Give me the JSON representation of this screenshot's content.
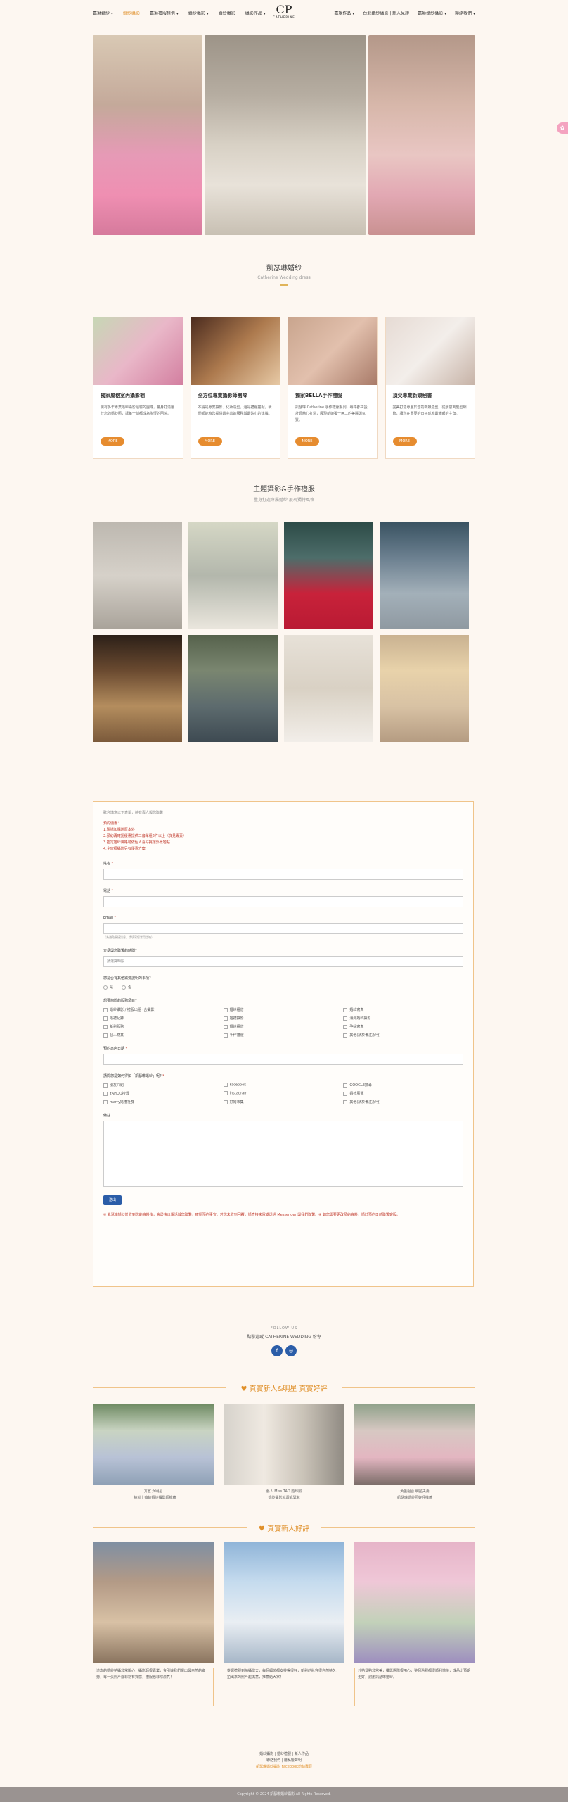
{
  "nav": {
    "left": [
      "嘉琳婚紗 ▾",
      "婚紗攝影",
      "嘉琳禮服租借 ▾",
      "婚紗攝影 ▾",
      "婚紗攝影",
      "攝影作品 ▾"
    ],
    "right": [
      "嘉琳作品 ▾",
      "台北婚紗攝影 | 新人見證",
      "嘉琳婚紗攝影 ▾",
      "聯絡我們 ▾"
    ],
    "active_index": 1
  },
  "logo": {
    "mark": "CP",
    "text": "CATHERINE"
  },
  "side_tab": "✿",
  "section1": {
    "title": "凱瑟琳婚紗",
    "subtitle": "Catherine Wedding dress"
  },
  "cards": [
    {
      "title": "獨家風格室內攝影棚",
      "desc": "擁有多年專業婚紗攝影經驗的團隊，量身打造屬於您的婚紗照，讓每一刻都成為永恆的回憶。",
      "more": "MORE"
    },
    {
      "title": "全方位專業攝影師團隊",
      "desc": "不論是專業攝影、化妝造型，還是禮服搭配，我們都能為您提供最完善的服務與最貼心的建議。",
      "more": "MORE"
    },
    {
      "title": "獨家BELLA手作禮服",
      "desc": "凱瑟琳 Catherine 手作禮服系列，每件都由設計師精心打造，展現新娘獨一無二的美麗與氣質。",
      "more": "MORE"
    },
    {
      "title": "頂尖專業新娘秘書",
      "desc": "完美打造專屬於您的新娘造型，從妝容到髮型細節，讓您在重要的日子成為最耀眼的主角。",
      "more": "MORE"
    }
  ],
  "section2": {
    "title": "主題攝影&手作禮服",
    "subtitle": "量身打造專屬婚紗 展現獨特風格"
  },
  "form": {
    "note": "歡迎填寫以下表單，將有專人與您聯繫",
    "warnings": [
      "預約優惠：",
      "1.現場加購送原本外",
      "2.預約再確認優惠提供三套單租2件以上（詳見專頁）",
      "3.指定婚紗風格可依個人喜好挑選外景地點",
      "4.全家福攝影另有優惠方案"
    ],
    "name_label": "姓名",
    "phone_label": "電話",
    "email_label": "Email",
    "email_help": "（為避免漏接訊息，請填寫您常用信箱）",
    "budget_label": "方便與您聯繫的時間?",
    "budget_value": "請選擇時段",
    "contact_label": "您是否有其他需要說明的事項?",
    "radio": [
      "是",
      "否"
    ],
    "services_label": "想要詢問的服務項目?",
    "services": [
      "婚紗攝影 / 禮服出租 (含攝影)",
      "婚紗租借",
      "婚紗寫真",
      "婚禮紀錄",
      "婚禮攝影",
      "海外婚紗攝影",
      "新秘服務",
      "婚紗租借",
      "孕婦寫真",
      "個人寫真",
      "手作禮服",
      "其他(請於備註說明)"
    ],
    "date_label": "預約來店日期",
    "source_label": "請問您是如何得知「凱瑟琳婚紗」呢?",
    "sources": [
      "朋友介紹",
      "Facebook",
      "GOOGLE搜尋",
      "YAHOO搜尋",
      "Instagram",
      "婚禮展覽",
      "marry婚禮社群",
      "好婚市集",
      "其他(請於備註說明)"
    ],
    "notes_label": "備註",
    "submit": "送出",
    "footer": "※ 凱瑟琳婚紗於收到您的資料後，會盡快以電話與您聯繫，確認預約事宜。若您未收到回覆，請直接來電或透過 Messenger 與我們聯繫。※ 如您需要更改預約資料，請於預約日前聯繫客服。"
  },
  "follow": {
    "title": "FOLLOW US",
    "subtitle": "點擊追蹤 CATHERINE WEDDING 粉專",
    "fb": "f",
    "ig": "◎"
  },
  "reviews1": {
    "title": "♥ 真實新人&明星 真實好評",
    "items": [
      {
        "caption": "方宣 女明星\n一拍就上癮的婚紗攝影師推薦"
      },
      {
        "caption": "藝人 Miss TAO 婚紗照\n婚紗攝影就選凱瑟琳"
      },
      {
        "caption": "黃金組合 明星夫妻\n凱瑟琳婚紗照好評推薦"
      }
    ]
  },
  "reviews2": {
    "title": "♥ 真實新人好評",
    "items": [
      {
        "text": "這次的婚紗拍攝非常開心，攝影師很專業，會引導我們擺出最自然的姿勢，每一張照片都非常有質感，禮服也非常漂亮！"
      },
      {
        "text": "從選禮服到拍攝當天，每個細節都安排得很好，新秘的妝容很自然持久，拍出來的照片超滿意，推薦給大家！"
      },
      {
        "text": "外拍景點非常美，攝影團隊很用心，整個過程都很順利愉快，成品比預期更好，謝謝凱瑟琳婚紗。"
      }
    ]
  },
  "footer": {
    "links": "婚紗攝影 | 婚紗禮服 | 新人作品",
    "line2": "聯絡我們 | 隱私權聲明",
    "line3": "凱瑟琳婚紗攝影 Facebook粉絲專頁",
    "copyright": "Copyright © 2024 凱瑟琳婚紗攝影 All Rights Reserved."
  }
}
